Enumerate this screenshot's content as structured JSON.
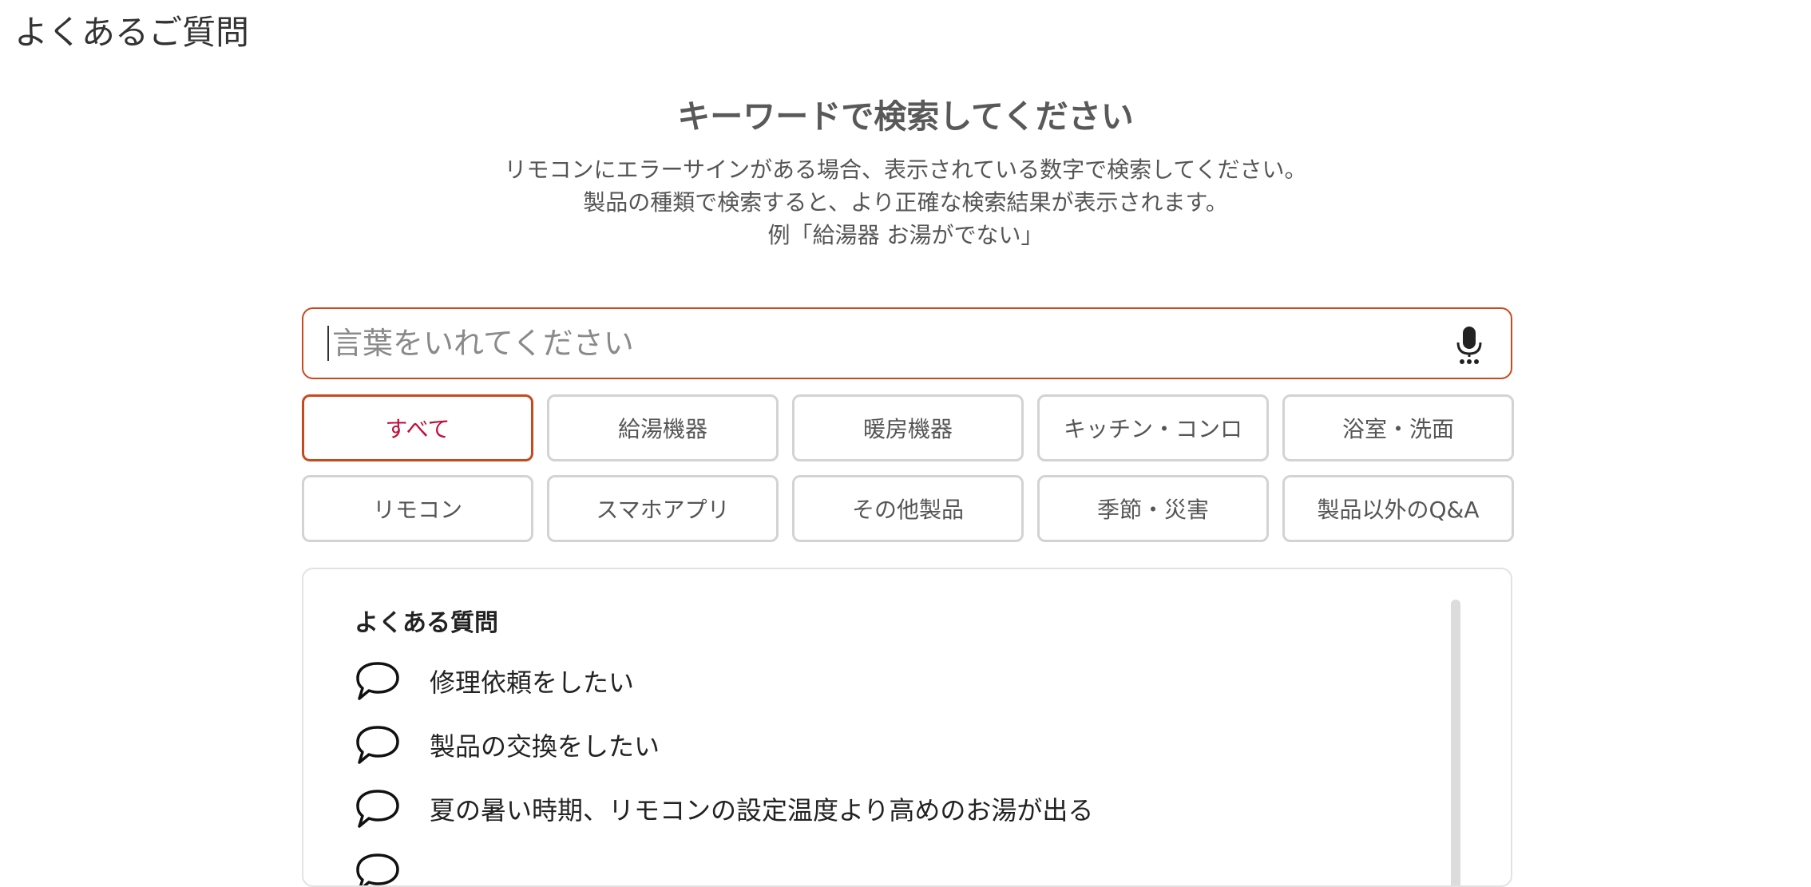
{
  "page": {
    "title": "よくあるご質問"
  },
  "search": {
    "heading": "キーワードで検索してください",
    "description_lines": [
      "リモコンにエラーサインがある場合、表示されている数字で検索してください。",
      "製品の種類で検索すると、より正確な検索結果が表示されます。",
      "例「給湯器 お湯がでない」"
    ],
    "placeholder": "言葉をいれてください",
    "value": "",
    "mic_icon": "microphone-icon"
  },
  "categories": [
    {
      "label": "すべて",
      "active": true
    },
    {
      "label": "給湯機器",
      "active": false
    },
    {
      "label": "暖房機器",
      "active": false
    },
    {
      "label": "キッチン・コンロ",
      "active": false
    },
    {
      "label": "浴室・洗面",
      "active": false
    },
    {
      "label": "リモコン",
      "active": false
    },
    {
      "label": "スマホアプリ",
      "active": false
    },
    {
      "label": "その他製品",
      "active": false
    },
    {
      "label": "季節・災害",
      "active": false
    },
    {
      "label": "製品以外のQ&A",
      "active": false
    }
  ],
  "faq": {
    "title": "よくある質問",
    "item_icon": "speech-bubble-icon",
    "items": [
      "修理依頼をしたい",
      "製品の交換をしたい",
      "夏の暑い時期、リモコンの設定温度より高めのお湯が出る",
      ""
    ]
  },
  "colors": {
    "accent_border": "#c9491e",
    "active_text": "#c20e3a",
    "button_border": "#d3d3d3"
  }
}
